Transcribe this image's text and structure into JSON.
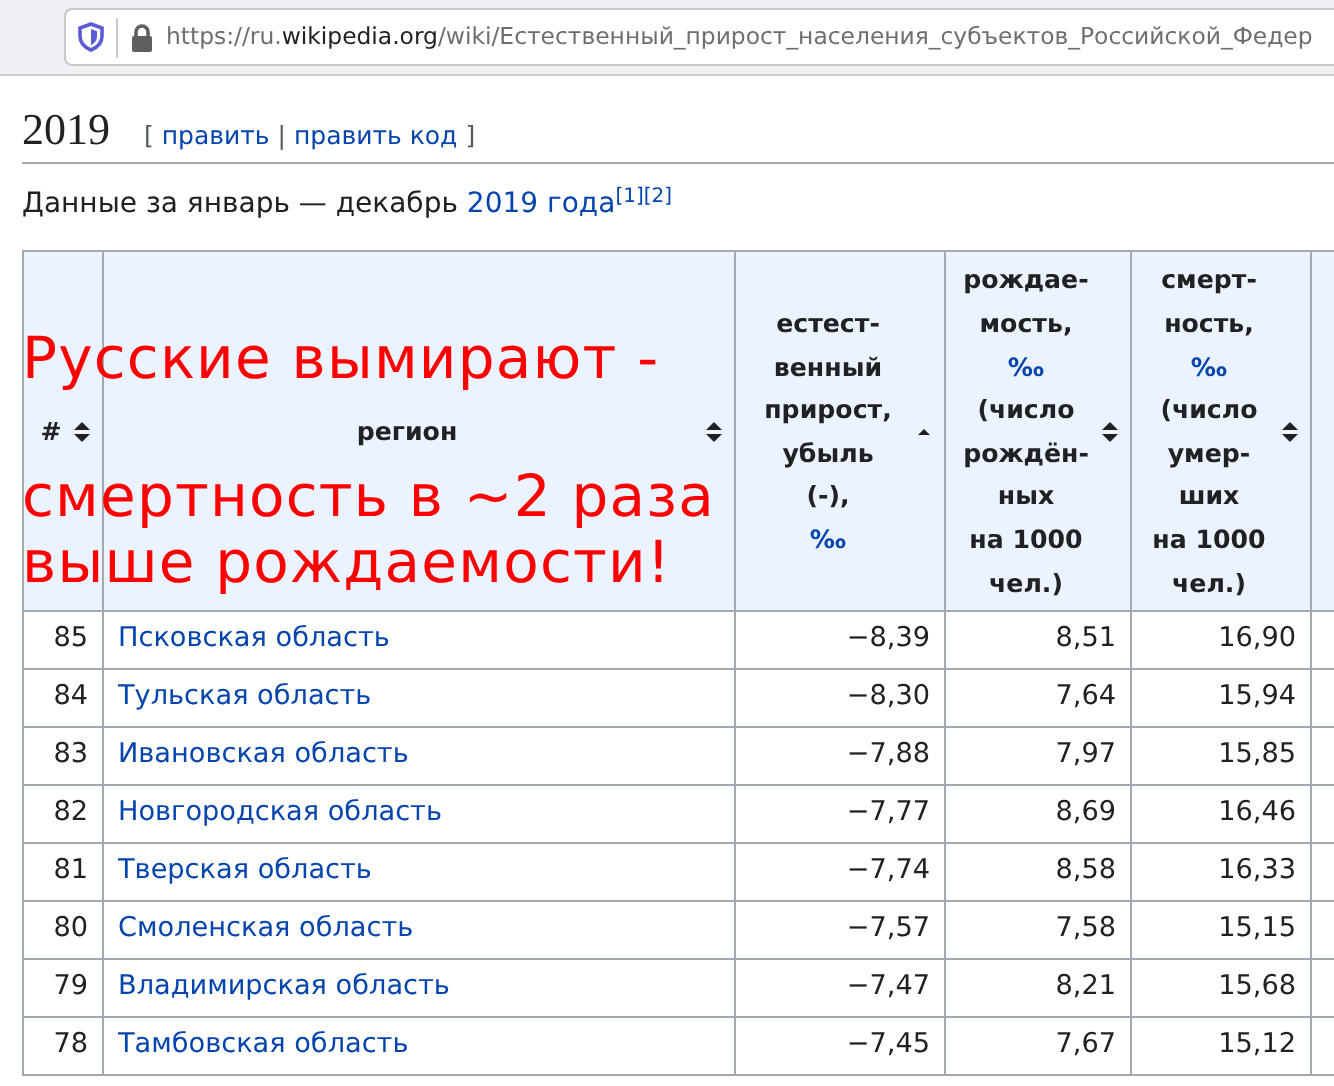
{
  "browser": {
    "url_scheme": "https://ru.",
    "url_domain": "wikipedia.org",
    "url_path": "/wiki/Естественный_прирост_населения_субъектов_Российской_Федер"
  },
  "section": {
    "title": "2019",
    "edit_links": [
      {
        "text": "править"
      },
      {
        "text": "править код"
      }
    ],
    "open_bracket": "[",
    "separator": "|",
    "close_bracket": "]"
  },
  "intro": {
    "text": "Данные за январь — декабрь ",
    "link": "2019 года",
    "refs": [
      "[1]",
      "[2]"
    ]
  },
  "table": {
    "columns": [
      {
        "lines": [
          {
            "text": "#",
            "link": false
          }
        ],
        "sorted": false
      },
      {
        "lines": [
          {
            "text": "регион",
            "link": false
          }
        ],
        "sorted": false
      },
      {
        "lines": [
          {
            "text": "естест-",
            "link": false
          },
          {
            "text": "венный",
            "link": false
          },
          {
            "text": "прирост,",
            "link": false
          },
          {
            "text": "убыль",
            "link": false
          },
          {
            "text": "(-),",
            "link": false
          },
          {
            "text": "‰",
            "link": true
          }
        ],
        "sorted": true
      },
      {
        "lines": [
          {
            "text": "рождае-",
            "link": false
          },
          {
            "text": "мость,",
            "link": false
          },
          {
            "text": "‰",
            "link": true
          },
          {
            "text": "(число",
            "link": false
          },
          {
            "text": "рождён-",
            "link": false
          },
          {
            "text": "ных",
            "link": false
          },
          {
            "text": "на 1000",
            "link": false
          },
          {
            "text": "чел.)",
            "link": false
          }
        ],
        "sorted": false
      },
      {
        "lines": [
          {
            "text": "смерт-",
            "link": false
          },
          {
            "text": "ность,",
            "link": false
          },
          {
            "text": "‰",
            "link": true
          },
          {
            "text": "(число",
            "link": false
          },
          {
            "text": "умер-",
            "link": false
          },
          {
            "text": "ших",
            "link": false
          },
          {
            "text": "на 1000",
            "link": false
          },
          {
            "text": "чел.)",
            "link": false
          }
        ],
        "sorted": false
      }
    ],
    "rows": [
      [
        "85",
        "Псковская область",
        "−8,39",
        "8,51",
        "16,90"
      ],
      [
        "84",
        "Тульская область",
        "−8,30",
        "7,64",
        "15,94"
      ],
      [
        "83",
        "Ивановская область",
        "−7,88",
        "7,97",
        "15,85"
      ],
      [
        "82",
        "Новгородская область",
        "−7,77",
        "8,69",
        "16,46"
      ],
      [
        "81",
        "Тверская область",
        "−7,74",
        "8,58",
        "16,33"
      ],
      [
        "80",
        "Смоленская область",
        "−7,57",
        "7,58",
        "15,15"
      ],
      [
        "79",
        "Владимирская область",
        "−7,47",
        "8,21",
        "15,68"
      ],
      [
        "78",
        "Тамбовская область",
        "−7,45",
        "7,67",
        "15,12"
      ]
    ]
  },
  "overlay_caption": [
    "Русские вымирают -",
    "смертность в ~2 раза",
    "выше рождаемости!"
  ]
}
